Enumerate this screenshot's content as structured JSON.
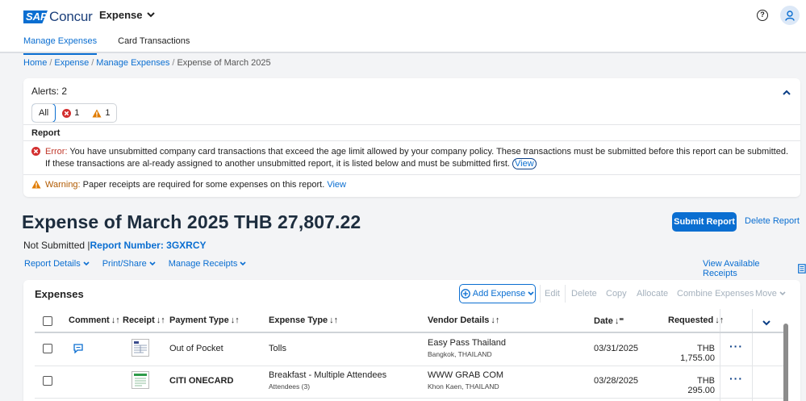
{
  "header": {
    "logo_sap": "SAP",
    "logo_concur": "Concur",
    "product": "Expense",
    "tabs": [
      {
        "label": "Manage Expenses",
        "active": true
      },
      {
        "label": "Card Transactions",
        "active": false
      }
    ]
  },
  "breadcrumb": [
    "Home",
    "Expense",
    "Manage Expenses",
    "Expense of March 2025"
  ],
  "alerts": {
    "title": "Alerts: 2",
    "filter_all": "All",
    "error_count": "1",
    "warning_count": "1",
    "section_label": "Report",
    "error_prefix": "Error:",
    "error_text": "You have unsubmitted company card transactions that exceed the age limit allowed by your company policy. These transactions must be submitted before this report can be submitted. If these transactions are al-ready assigned to another unsubmitted report, it is listed below and must be submitted first.",
    "error_link": "View",
    "warning_prefix": "Warning:",
    "warning_text": "Paper receipts are required for some expenses on this report.",
    "warning_link": "View"
  },
  "report": {
    "title": "Expense of March 2025 THB 27,807.22",
    "submit_label": "Submit Report",
    "delete_label": "Delete Report",
    "status": "Not Submitted",
    "report_number_label": "Report Number: 3GXRCY",
    "menus": [
      "Report Details",
      "Print/Share",
      "Manage Receipts"
    ],
    "view_receipts": "View Available Receipts"
  },
  "expenses": {
    "title": "Expenses",
    "add_label": "Add Expense",
    "toolbar": [
      "Edit",
      "Delete",
      "Copy",
      "Allocate",
      "Combine Expenses",
      "Move"
    ],
    "columns": [
      "Comment",
      "Receipt",
      "Payment Type",
      "Expense Type",
      "Vendor Details",
      "Date",
      "Requested"
    ],
    "rows": [
      {
        "payment_type": "Out of Pocket",
        "expense_type": "Tolls",
        "attendees": "",
        "vendor": "Easy Pass Thailand",
        "location": "Bangkok, THAILAND",
        "date": "03/31/2025",
        "amount": "THB 1,755.00"
      },
      {
        "payment_type": "CITI ONECARD",
        "expense_type": "Breakfast - Multiple Attendees",
        "attendees": "Attendees (3)",
        "vendor": "WWW GRAB COM",
        "location": "Khon Kaen, THAILAND",
        "date": "03/28/2025",
        "amount": "THB 295.00"
      }
    ]
  },
  "colors": {
    "accent": "#0a6ed1",
    "error": "#d32f2f",
    "warning": "#e07b00"
  }
}
